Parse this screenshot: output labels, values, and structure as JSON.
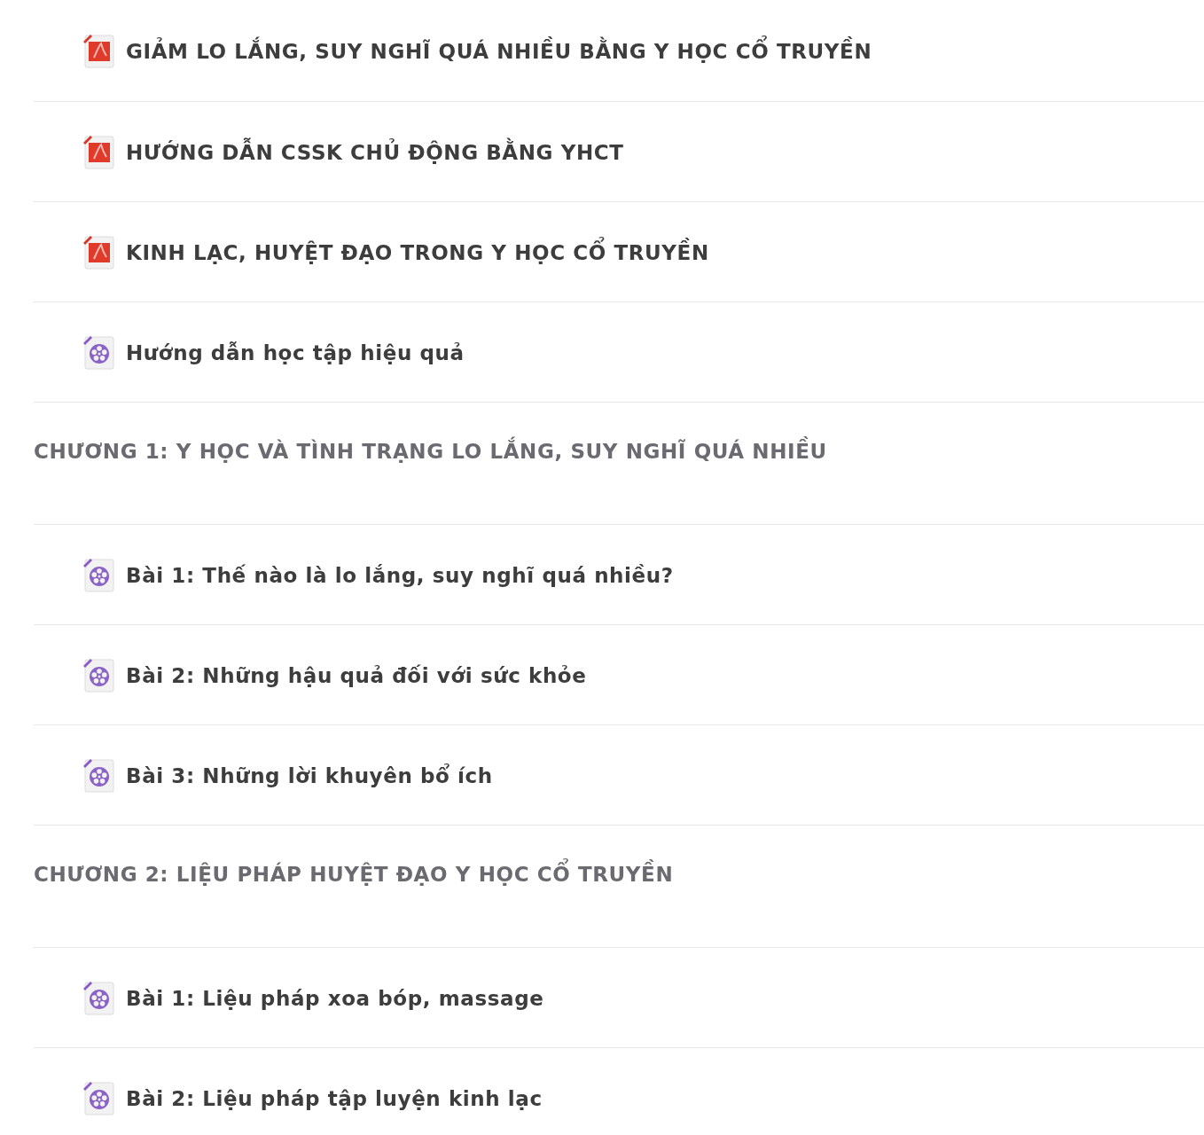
{
  "entries": [
    {
      "kind": "pdf",
      "title": "GIẢM LO LẮNG, SUY NGHĨ QUÁ NHIỀU BẰNG Y HỌC CỔ TRUYỀN"
    },
    {
      "kind": "pdf",
      "title": "HƯỚNG DẪN CSSK CHỦ ĐỘNG BẰNG YHCT"
    },
    {
      "kind": "pdf",
      "title": "KINH LẠC, HUYỆT ĐẠO TRONG Y HỌC CỔ TRUYỀN"
    },
    {
      "kind": "video",
      "title": "Hướng dẫn học tập hiệu quả"
    },
    {
      "kind": "section",
      "title": "CHƯƠNG 1: Y HỌC VÀ TÌNH TRẠNG LO LẮNG, SUY NGHĨ QUÁ NHIỀU"
    },
    {
      "kind": "video",
      "title": "Bài 1: Thế nào là lo lắng, suy nghĩ quá nhiều?"
    },
    {
      "kind": "video",
      "title": "Bài 2: Những hậu quả đối với sức khỏe"
    },
    {
      "kind": "video",
      "title": "Bài 3: Những lời khuyên bổ ích"
    },
    {
      "kind": "section",
      "title": "CHƯƠNG 2: LIỆU PHÁP HUYỆT ĐẠO Y HỌC CỔ TRUYỀN"
    },
    {
      "kind": "video",
      "title": "Bài 1: Liệu pháp xoa bóp, massage"
    },
    {
      "kind": "video",
      "title": "Bài 2: Liệu pháp tập luyện kinh lạc"
    }
  ]
}
